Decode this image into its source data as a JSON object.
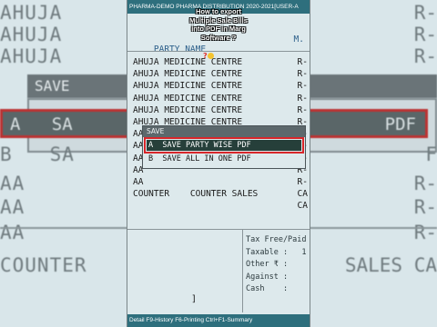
{
  "app": {
    "title": "PHARMA-DEMO PHARMA DISTRIBUTION 2020-2021[USER-A",
    "status": "Detail F9-History F6-Printing Ctrl+F1-Summary"
  },
  "list": {
    "column_party": "PARTY NAME",
    "column_right": "M.",
    "rows": [
      {
        "name": "AHUJA MEDICINE CENTRE",
        "suffix": "R-"
      },
      {
        "name": "AHUJA MEDICINE CENTRE",
        "suffix": "R-"
      },
      {
        "name": "AHUJA MEDICINE CENTRE",
        "suffix": "R-"
      },
      {
        "name": "AHUJA MEDICINE CENTRE",
        "suffix": "R-"
      },
      {
        "name": "AHUJA MEDICINE CENTRE",
        "suffix": "R-"
      },
      {
        "name": "AHUJA MEDICINE CENTRE",
        "suffix": "R-"
      },
      {
        "name": "AA",
        "suffix": "R-"
      },
      {
        "name": "AA",
        "suffix": "R-"
      },
      {
        "name": "AA",
        "suffix": "R-"
      },
      {
        "name": "AA",
        "suffix": "R-"
      },
      {
        "name": "AA",
        "suffix": "R-"
      },
      {
        "name": "COUNTER    COUNTER SALES",
        "suffix": "CA"
      },
      {
        "name": "",
        "suffix": "CA"
      }
    ]
  },
  "summary": {
    "lines": [
      "Tax Free/Paid",
      "Taxable :   1",
      "Other ₹ :",
      "Against :",
      "Cash    :"
    ]
  },
  "bracket": "]",
  "popup": {
    "title": "SAVE",
    "options": [
      {
        "key": "A",
        "label": "SAVE PARTY WISE PDF",
        "selected": true
      },
      {
        "key": "B",
        "label": "SAVE ALL IN ONE PDF",
        "selected": false
      }
    ]
  },
  "caption": {
    "lines": [
      "How to export",
      "Multiple Sale Bills",
      "into PDF in Marg",
      "Software ?"
    ]
  },
  "background": {
    "lines": [
      {
        "text": "AHUJA",
        "right": "R-"
      },
      {
        "text": "AHUJA",
        "right": "R-"
      },
      {
        "text": "AHUJA",
        "right": "R-"
      },
      {
        "text": "SAVE",
        "right": ""
      },
      {
        "text": "A   SA",
        "right": "PDF"
      },
      {
        "text": "B   SA",
        "right": "F"
      },
      {
        "text": "AA",
        "right": "R-"
      },
      {
        "text": "AA",
        "right": "R-"
      },
      {
        "text": "AA",
        "right": "R-"
      },
      {
        "text": "COUNTER",
        "right": "SALES  CA"
      }
    ]
  },
  "colors": {
    "titlebar": "#2e6f7d",
    "selected_bg": "#263f3a",
    "highlight_border": "#d8262a"
  }
}
